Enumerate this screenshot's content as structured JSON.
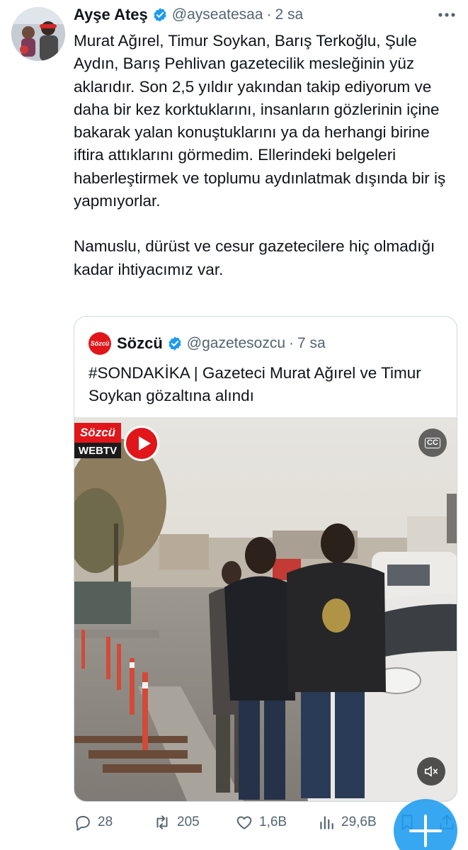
{
  "tweet": {
    "author": {
      "display_name": "Ayşe Ateş",
      "handle": "@ayseatesaa",
      "separator": "·",
      "time": "2 sa",
      "verified": true
    },
    "paragraphs": [
      "Murat Ağırel, Timur Soykan, Barış Terkoğlu, Şule Aydın, Barış Pehlivan gazetecilik mesleğinin yüz aklarıdır. Son 2,5 yıldır yakından takip ediyorum ve daha bir kez korktuklarını, insanların gözlerinin içine bakarak yalan konuştuklarını ya da herhangi birine iftira attıklarını görmedim. Ellerindeki belgeleri haberleştirmek ve toplumu aydınlatmak dışında bir iş yapmıyorlar.",
      "Namuslu, dürüst ve cesur gazetecilere hiç olmadığı kadar ihtiyacımız var."
    ]
  },
  "quoted": {
    "avatar_text": "Sözcü",
    "display_name": "Sözcü",
    "handle": "@gazetesozcu",
    "separator": "·",
    "time": "7 sa",
    "text": "#SONDAKİKA | Gazeteci Murat Ağırel ve Timur Soykan gözaltına alındı",
    "video": {
      "brand_top": "Sözcü",
      "brand_bottom": "WEBTV",
      "cc_label": "CC"
    }
  },
  "actions": {
    "replies": "28",
    "retweets": "205",
    "likes": "1,6B",
    "views": "29,6B"
  },
  "colors": {
    "accent": "#1d9bf0",
    "brand_red": "#e0161b",
    "muted_text": "#536471"
  }
}
